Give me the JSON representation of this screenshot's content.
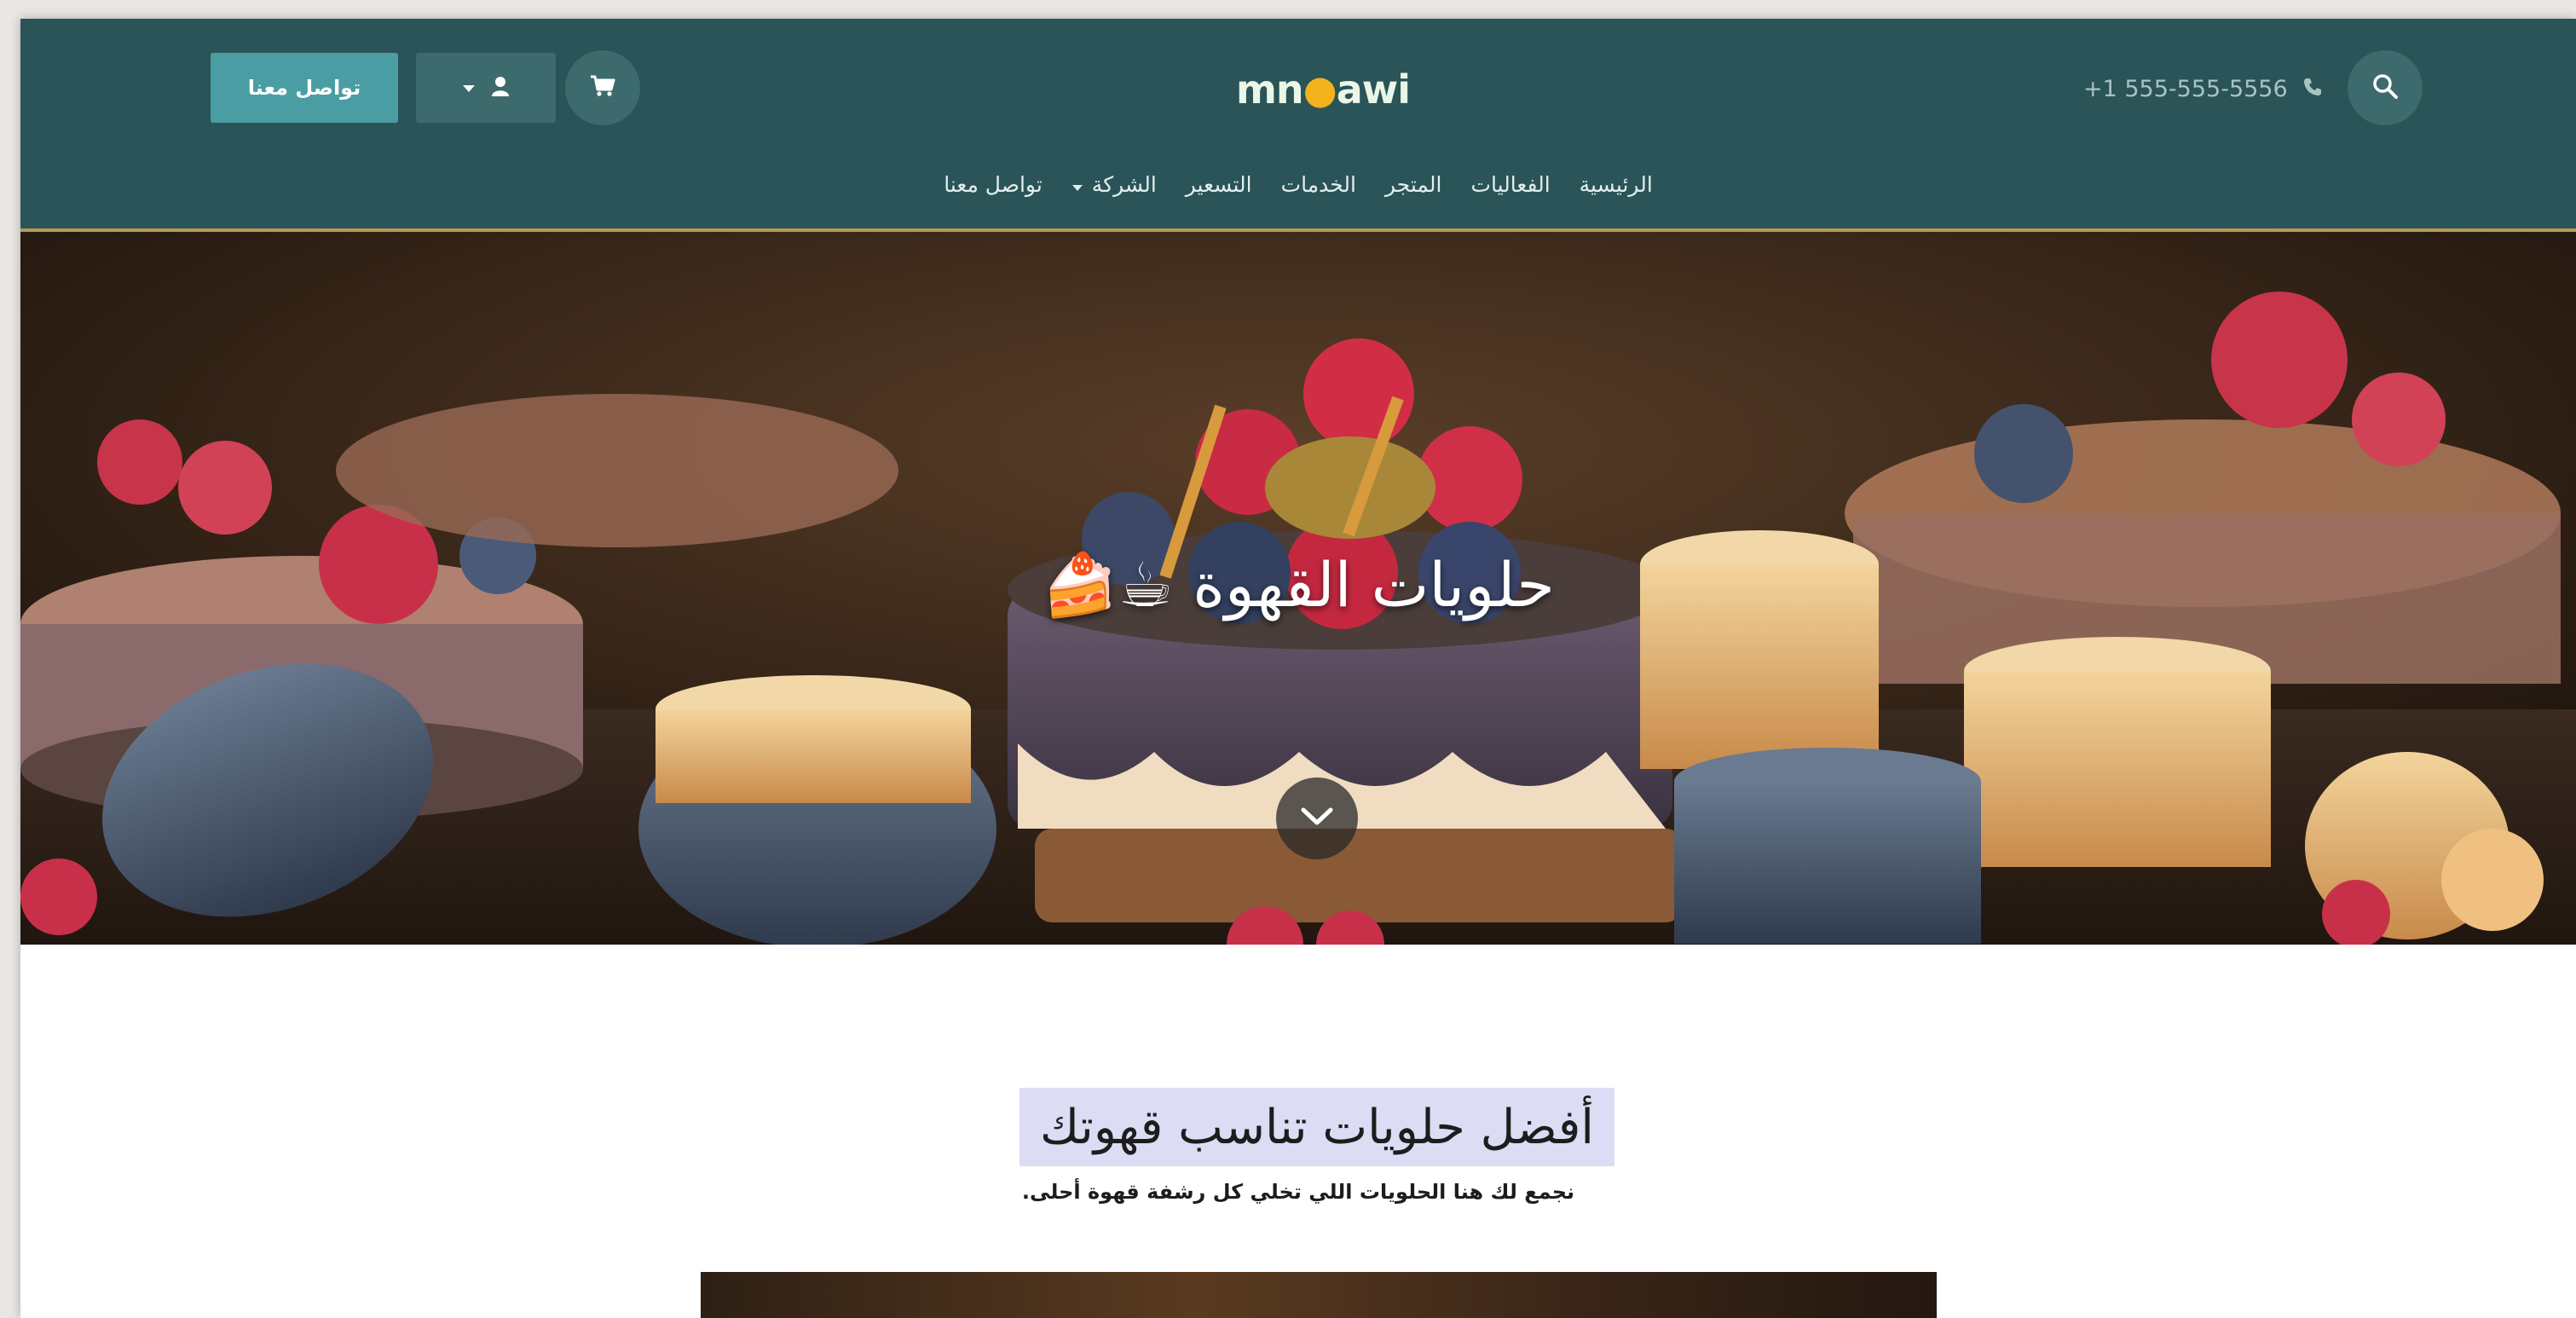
{
  "header": {
    "contact_button": "تواصل معنا",
    "logo": {
      "before": "mn",
      "accent": "●",
      "after": "awi"
    },
    "phone": "+1 555-555-5556",
    "icons": {
      "cart": "cart-icon",
      "user": "user-icon",
      "search": "search-icon",
      "phone": "phone-icon"
    }
  },
  "nav": {
    "items": [
      {
        "label": "الرئيسية"
      },
      {
        "label": "الفعاليات"
      },
      {
        "label": "المتجر"
      },
      {
        "label": "الخدمات"
      },
      {
        "label": "التسعير"
      },
      {
        "label": "الشركة",
        "dropdown": true
      },
      {
        "label": "تواصل معنا"
      }
    ]
  },
  "hero": {
    "title": "حلويات القهوة ☕🍰"
  },
  "section": {
    "title": "أفضل حلويات تناسب قهوتك",
    "subtitle": "نجمع لك هنا الحلويات اللي تخلي كل رشفة قهوة أحلى."
  },
  "colors": {
    "header_bg": "#2a5457",
    "button_bg": "#4a9ea3",
    "accent": "#b59a52"
  }
}
